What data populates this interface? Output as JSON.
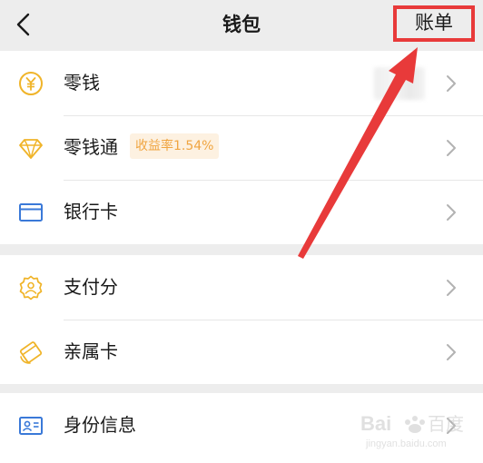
{
  "header": {
    "title": "钱包",
    "bill_label": "账单"
  },
  "groups": [
    {
      "items": [
        {
          "label": "零钱",
          "icon": "yen-coin-icon"
        },
        {
          "label": "零钱通",
          "icon": "diamond-icon",
          "badge": "收益率1.54%"
        },
        {
          "label": "银行卡",
          "icon": "bank-card-icon"
        }
      ]
    },
    {
      "items": [
        {
          "label": "支付分",
          "icon": "badge-person-icon"
        },
        {
          "label": "亲属卡",
          "icon": "family-card-icon"
        }
      ]
    },
    {
      "items": [
        {
          "label": "身份信息",
          "icon": "id-card-icon"
        }
      ]
    }
  ],
  "colors": {
    "accent_yellow": "#f0b429",
    "accent_blue": "#3a79d8",
    "annotation_red": "#e83a3a",
    "badge_text": "#f0a541",
    "badge_bg": "#fdf1e1"
  },
  "watermark": {
    "logo_text": "Bai 百度",
    "sub_text": "jingyan.baidu.com"
  }
}
